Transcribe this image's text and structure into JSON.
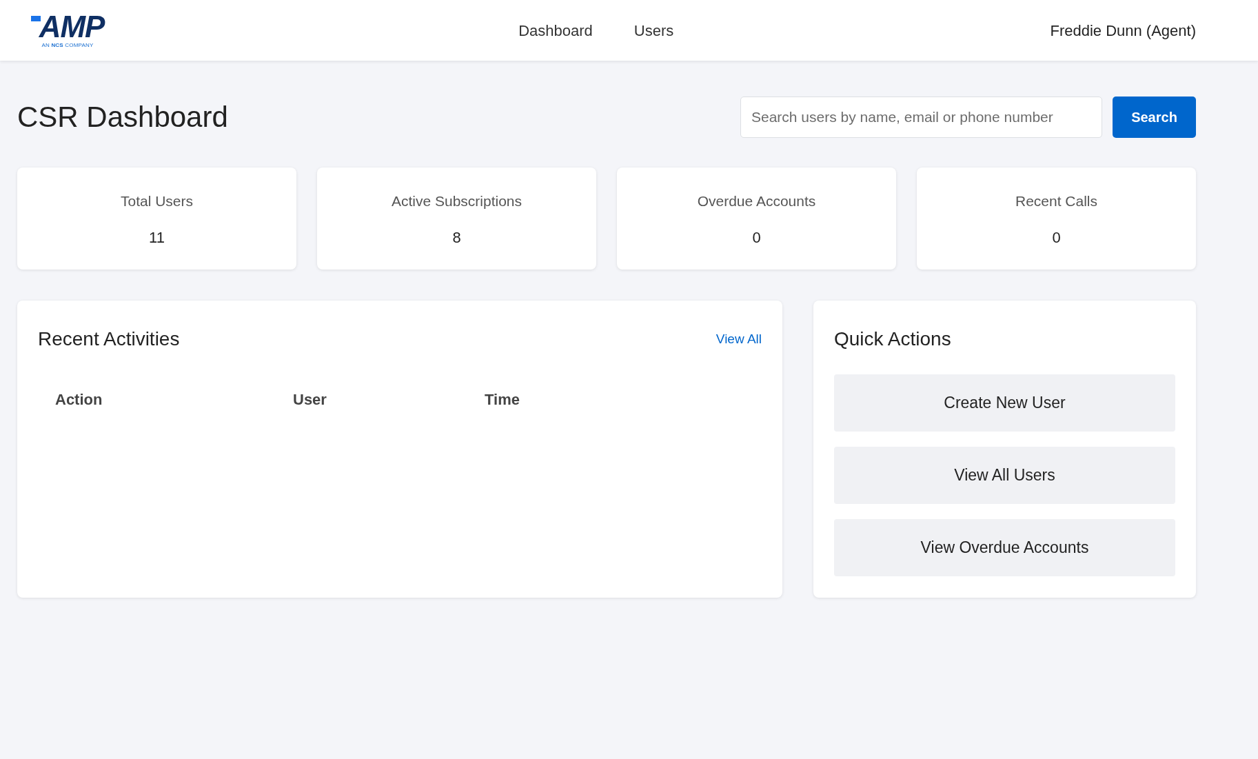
{
  "header": {
    "logo": {
      "wordmark": "AMP",
      "tagline": "AN **NCS** COMPANY"
    },
    "nav": [
      {
        "label": "Dashboard"
      },
      {
        "label": "Users"
      }
    ],
    "user": "Freddie Dunn (Agent)"
  },
  "page_title": "CSR Dashboard",
  "search": {
    "placeholder": "Search users by name, email or phone number",
    "button": "Search"
  },
  "stats": [
    {
      "label": "Total Users",
      "value": "11"
    },
    {
      "label": "Active Subscriptions",
      "value": "8"
    },
    {
      "label": "Overdue Accounts",
      "value": "0"
    },
    {
      "label": "Recent Calls",
      "value": "0"
    }
  ],
  "recent_activities": {
    "title": "Recent Activities",
    "link": "View All",
    "columns": [
      "Action",
      "User",
      "Time"
    ]
  },
  "quick_actions": {
    "title": "Quick Actions",
    "buttons": [
      "Create New User",
      "View All Users",
      "View Overdue Accounts"
    ]
  }
}
